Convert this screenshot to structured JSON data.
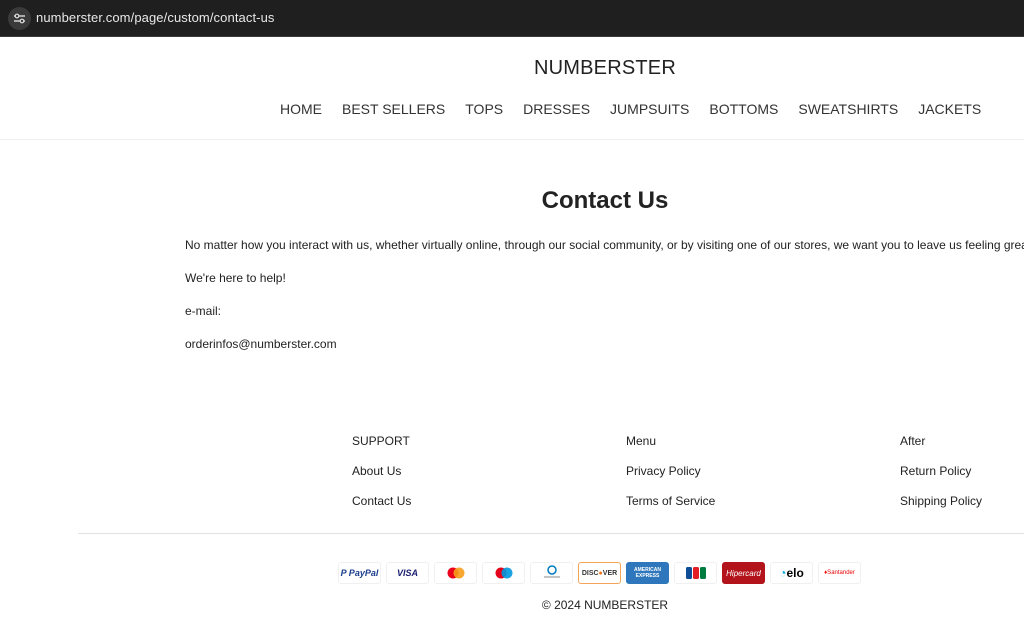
{
  "browser": {
    "url": "numberster.com/page/custom/contact-us"
  },
  "header": {
    "logo": "NUMBERSTER",
    "nav": [
      "HOME",
      "BEST SELLERS",
      "TOPS",
      "DRESSES",
      "JUMPSUITS",
      "BOTTOMS",
      "SWEATSHIRTS",
      "JACKETS"
    ]
  },
  "main": {
    "title": "Contact Us",
    "paragraphs": [
      "No matter how you interact with us, whether virtually online, through our social community, or by visiting one of our stores, we want you to leave us feeling great.",
      "We're here to help!",
      "e-mail:",
      "orderinfos@numberster.com"
    ]
  },
  "footer": {
    "columns": [
      {
        "heading": "SUPPORT",
        "links": [
          "About Us",
          "Contact Us"
        ]
      },
      {
        "heading": "Menu",
        "links": [
          "Privacy Policy",
          "Terms of Service"
        ]
      },
      {
        "heading": "After",
        "links": [
          "Return Policy",
          "Shipping Policy"
        ]
      }
    ],
    "payments": [
      "PayPal",
      "VISA",
      "Mastercard",
      "Maestro",
      "Diners Club",
      "DISCOVER",
      "American Express",
      "JCB",
      "Hipercard",
      "elo",
      "Santander"
    ],
    "copyright": "© 2024 NUMBERSTER"
  }
}
